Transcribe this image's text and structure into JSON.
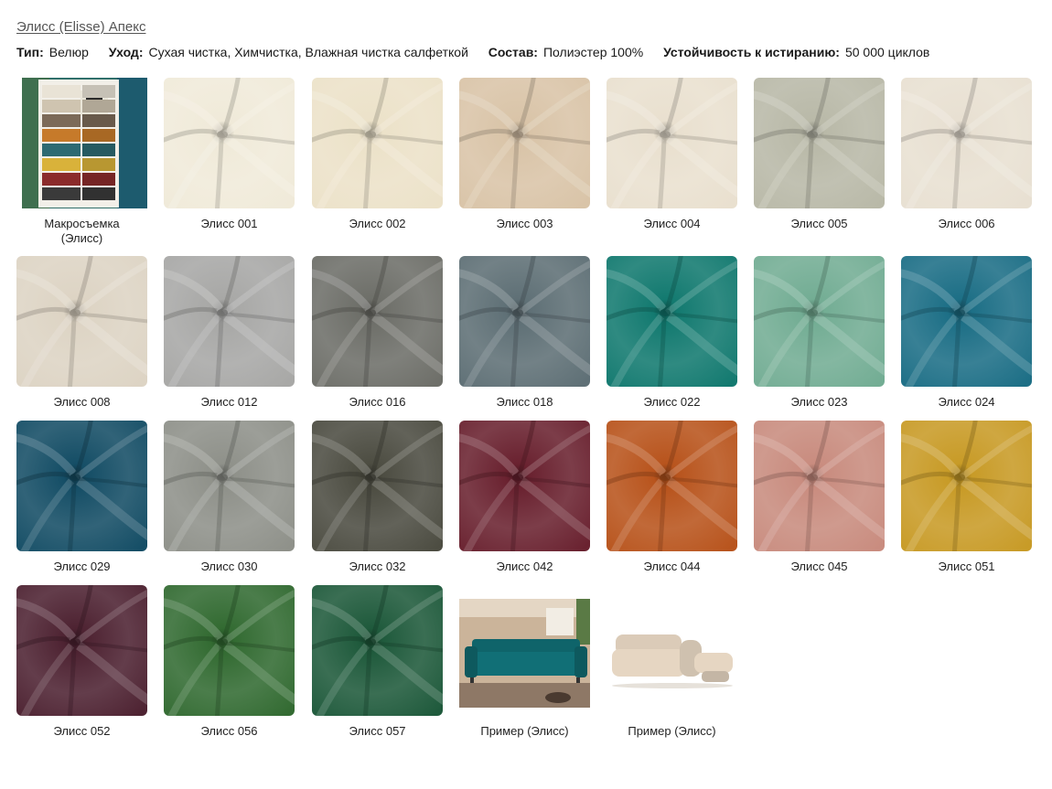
{
  "header": {
    "title": "Элисс (Elisse) Апекс",
    "specs": [
      {
        "key": "Тип:",
        "value": "Велюр"
      },
      {
        "key": "Уход:",
        "value": "Сухая чистка, Химчистка, Влажная чистка салфеткой"
      },
      {
        "key": "Состав:",
        "value": "Полиэстер 100%"
      },
      {
        "key": "Устойчивость к истиранию:",
        "value": "50 000 циклов"
      }
    ]
  },
  "swatches": [
    {
      "label": "Макросъемка (Элисс)",
      "kind": "macro",
      "color": "#2f6f6a"
    },
    {
      "label": "Элисс 001",
      "kind": "fabric",
      "color": "#f0ead9"
    },
    {
      "label": "Элисс 002",
      "kind": "fabric",
      "color": "#ece2c9"
    },
    {
      "label": "Элисс 003",
      "kind": "fabric",
      "color": "#d9c4a8"
    },
    {
      "label": "Элисс 004",
      "kind": "fabric",
      "color": "#e9e0cf"
    },
    {
      "label": "Элисс 005",
      "kind": "fabric",
      "color": "#b9b9a8"
    },
    {
      "label": "Элисс 006",
      "kind": "fabric",
      "color": "#e8e0d2"
    },
    {
      "label": "Элисс 008",
      "kind": "fabric",
      "color": "#ddd4c4"
    },
    {
      "label": "Элисс 012",
      "kind": "fabric",
      "color": "#a8a8a6"
    },
    {
      "label": "Элисс 016",
      "kind": "fabric",
      "color": "#6e6f69"
    },
    {
      "label": "Элисс 018",
      "kind": "fabric",
      "color": "#5f7076"
    },
    {
      "label": "Элисс 022",
      "kind": "fabric",
      "color": "#137a70"
    },
    {
      "label": "Элисс 023",
      "kind": "fabric",
      "color": "#73ad94"
    },
    {
      "label": "Элисс 024",
      "kind": "fabric",
      "color": "#1d6f86"
    },
    {
      "label": "Элисс 029",
      "kind": "fabric",
      "color": "#154e66"
    },
    {
      "label": "Элисс 030",
      "kind": "fabric",
      "color": "#8f918a"
    },
    {
      "label": "Элисс 032",
      "kind": "fabric",
      "color": "#4d4d42"
    },
    {
      "label": "Элисс 042",
      "kind": "fabric",
      "color": "#6a2230"
    },
    {
      "label": "Элисс 044",
      "kind": "fabric",
      "color": "#b8541d"
    },
    {
      "label": "Элисс 045",
      "kind": "fabric",
      "color": "#c98c7f"
    },
    {
      "label": "Элисс 051",
      "kind": "fabric",
      "color": "#c89b27"
    },
    {
      "label": "Элисс 052",
      "kind": "fabric",
      "color": "#4e2332"
    },
    {
      "label": "Элисс 056",
      "kind": "fabric",
      "color": "#336b32"
    },
    {
      "label": "Элисс 057",
      "kind": "fabric",
      "color": "#1f5a3c"
    },
    {
      "label": "Пример (Элисс)",
      "kind": "sofa-room",
      "color": "#116f76"
    },
    {
      "label": "Пример (Элисс)",
      "kind": "sofa-cut",
      "color": "#e6d6c2"
    }
  ]
}
